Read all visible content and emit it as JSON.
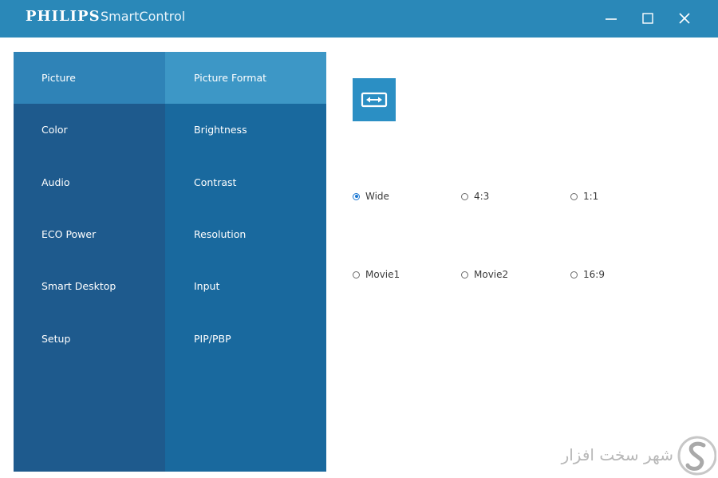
{
  "window": {
    "brand": "PHILIPS",
    "app_name": "SmartControl"
  },
  "menu_primary": {
    "items": [
      {
        "label": "Picture",
        "active": true
      },
      {
        "label": "Color",
        "active": false
      },
      {
        "label": "Audio",
        "active": false
      },
      {
        "label": "ECO Power",
        "active": false
      },
      {
        "label": "Smart Desktop",
        "active": false
      },
      {
        "label": "Setup",
        "active": false
      }
    ]
  },
  "menu_secondary": {
    "items": [
      {
        "label": "Picture Format",
        "active": true
      },
      {
        "label": "Brightness",
        "active": false
      },
      {
        "label": "Contrast",
        "active": false
      },
      {
        "label": "Resolution",
        "active": false
      },
      {
        "label": "Input",
        "active": false
      },
      {
        "label": "PIP/PBP",
        "active": false
      }
    ]
  },
  "picture_format": {
    "icon": "aspect-ratio-icon",
    "options": [
      {
        "label": "Wide",
        "checked": true
      },
      {
        "label": "4:3",
        "checked": false
      },
      {
        "label": "1:1",
        "checked": false
      },
      {
        "label": "Movie1",
        "checked": false
      },
      {
        "label": "Movie2",
        "checked": false
      },
      {
        "label": "16:9",
        "checked": false
      }
    ]
  },
  "watermark": {
    "text": "شهر سخت افزار"
  },
  "colors": {
    "titlebar": "#2a88b8",
    "menu_primary_bg": "#1e5a8d",
    "menu_secondary_bg": "#19699e",
    "active_primary": "#2f83b7",
    "active_secondary": "#3d97c6",
    "radio_checked": "#1976d2"
  }
}
